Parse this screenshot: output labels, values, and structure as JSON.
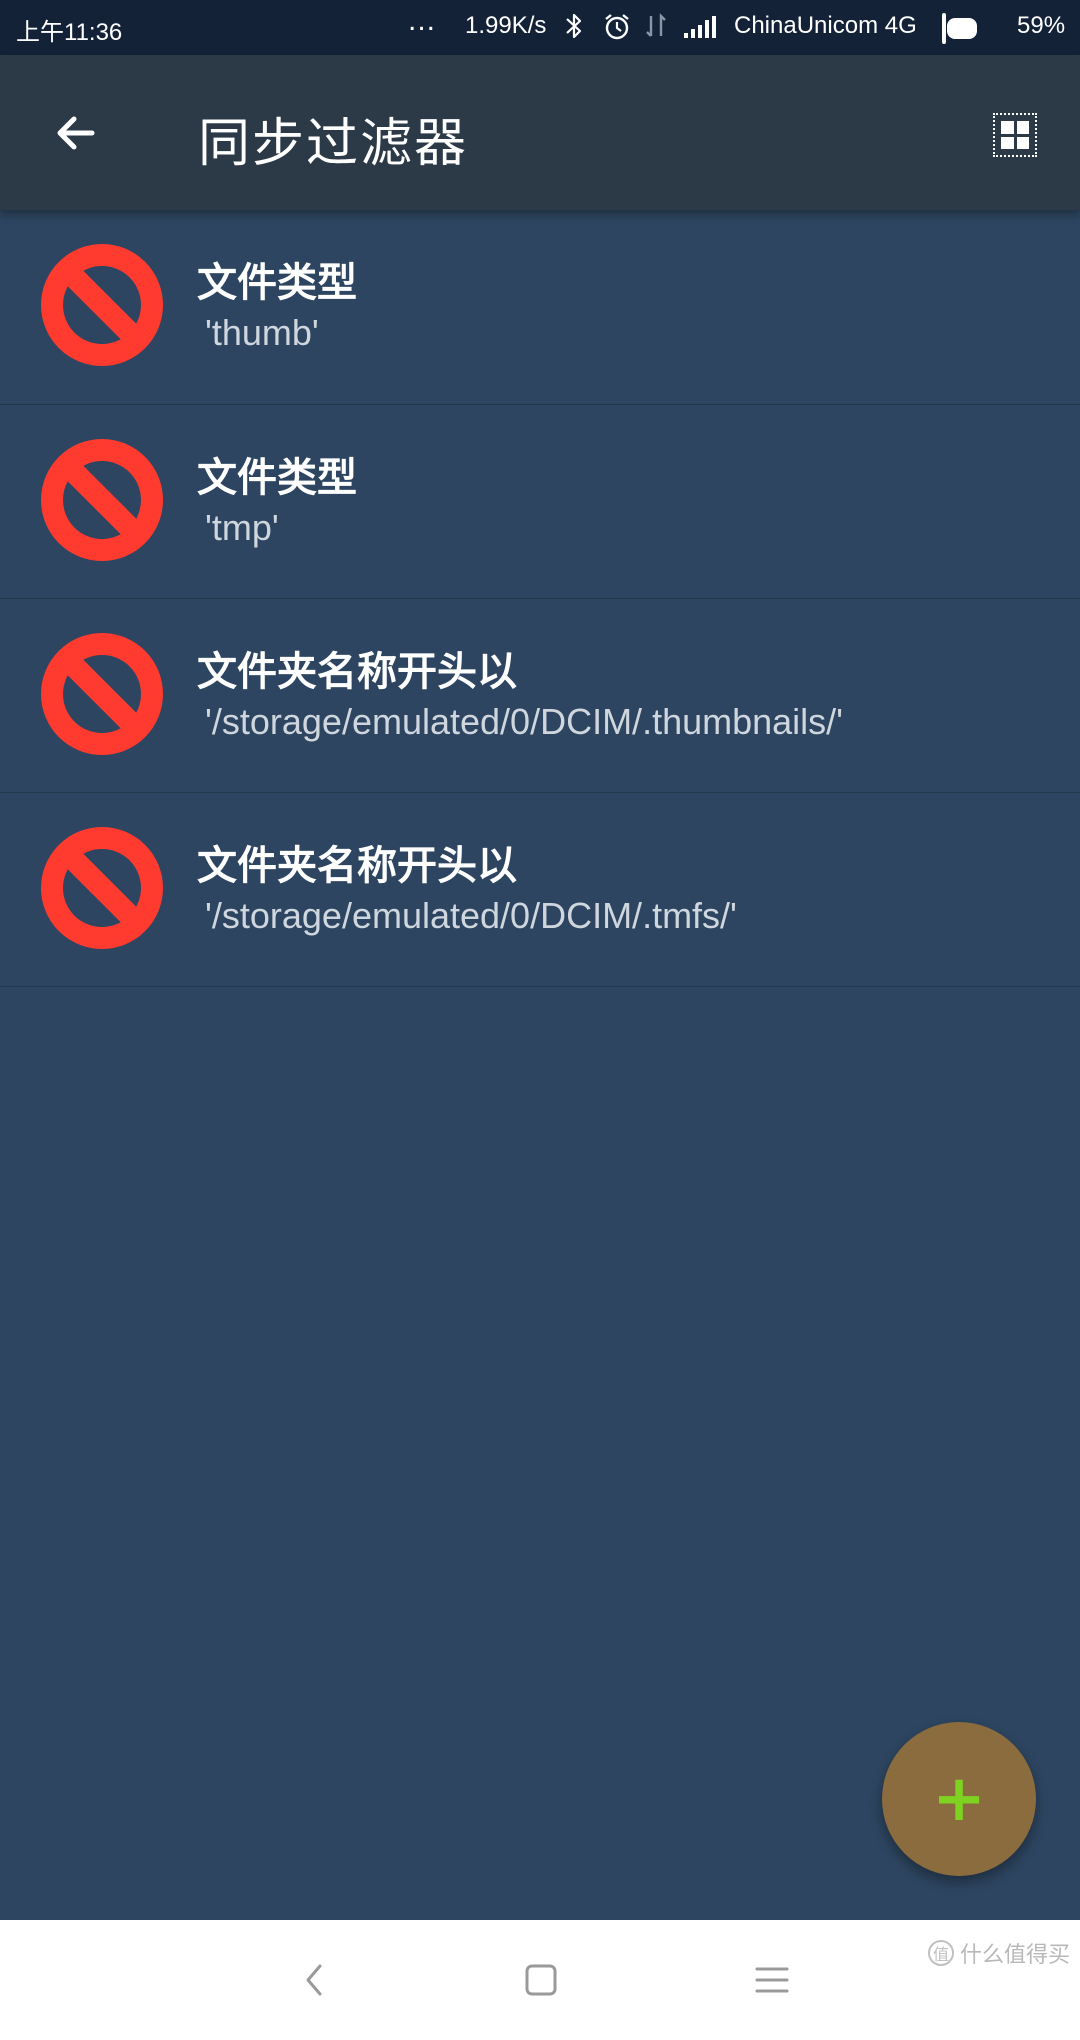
{
  "status_bar": {
    "time": "上午11:36",
    "dots": "...",
    "net_speed": "1.99K/s",
    "bluetooth_icon": "bluetooth-icon",
    "alarm_icon": "alarm-icon",
    "data_icon": "data-transfer-icon",
    "signal_icon": "signal-icon",
    "carrier": "ChinaUnicom 4G",
    "battery_level": 0.59,
    "battery_pct": "59%"
  },
  "app_bar": {
    "back_icon": "arrow-left-icon",
    "title": "同步过滤器",
    "action_icon": "grid-view-icon"
  },
  "filters": [
    {
      "title": "文件类型",
      "value": "'thumb'",
      "icon": "block-icon"
    },
    {
      "title": "文件类型",
      "value": "'tmp'",
      "icon": "block-icon"
    },
    {
      "title": "文件夹名称开头以",
      "value": "'/storage/emulated/0/DCIM/.thumbnails/'",
      "icon": "block-icon"
    },
    {
      "title": "文件夹名称开头以",
      "value": "'/storage/emulated/0/DCIM/.tmfs/'",
      "icon": "block-icon"
    }
  ],
  "fab": {
    "label": "+",
    "icon": "plus-icon"
  },
  "nav_bar": {
    "back_icon": "nav-back-icon",
    "home_icon": "nav-home-icon",
    "menu_icon": "nav-menu-icon"
  },
  "watermark": {
    "text": "什么值得买"
  },
  "colors": {
    "status_bar_bg": "#142238",
    "app_bar_bg": "#2c3947",
    "list_bg": "#2d4560",
    "block_red": "#ff3b30",
    "fab_bg": "#8b6c3e",
    "fab_plus": "#7ed321"
  }
}
